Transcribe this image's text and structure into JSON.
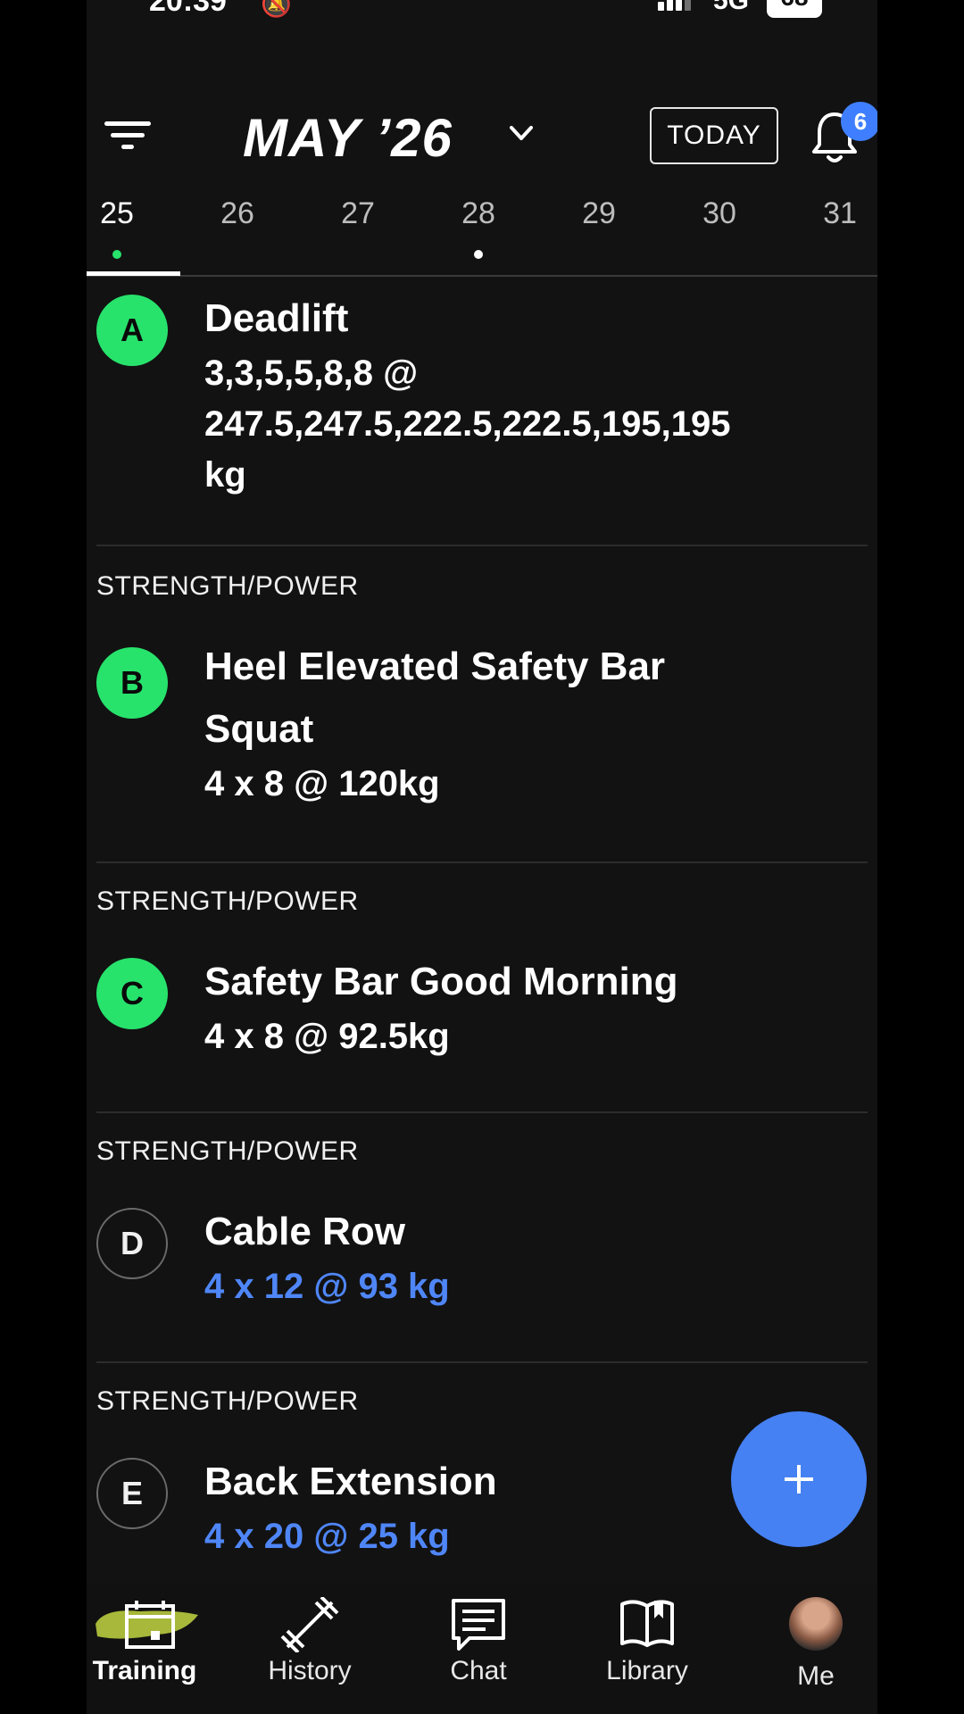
{
  "status_bar": {
    "time": "20:39",
    "network": "5G",
    "battery": "68"
  },
  "header": {
    "month": "MAY ’26",
    "today_label": "TODAY",
    "notification_count": "6"
  },
  "days": [
    {
      "label": "25",
      "active": true,
      "dot": "#27e36c"
    },
    {
      "label": "26"
    },
    {
      "label": "27"
    },
    {
      "label": "28",
      "dot": "#ffffff"
    },
    {
      "label": "29"
    },
    {
      "label": "30"
    },
    {
      "label": "31"
    }
  ],
  "exercises": [
    {
      "letter": "A",
      "category": "",
      "name_lines": [
        "Deadlift"
      ],
      "detail_lines": [
        "3,3,5,5,8,8 @",
        "247.5,247.5,222.5,222.5,195,195",
        "kg"
      ],
      "done": true
    },
    {
      "letter": "B",
      "category": "STRENGTH/POWER",
      "name_lines": [
        "Heel Elevated Safety Bar",
        "Squat"
      ],
      "detail_lines": [
        "4 x 8 @ 120kg"
      ],
      "done": true
    },
    {
      "letter": "C",
      "category": "STRENGTH/POWER",
      "name_lines": [
        "Safety Bar Good Morning"
      ],
      "detail_lines": [
        "4 x 8 @ 92.5kg"
      ],
      "done": true
    },
    {
      "letter": "D",
      "category": "STRENGTH/POWER",
      "name_lines": [
        "Cable Row"
      ],
      "detail_lines": [
        "4 x 12 @ 93 kg"
      ],
      "done": false
    },
    {
      "letter": "E",
      "category": "STRENGTH/POWER",
      "name_lines": [
        "Back Extension"
      ],
      "detail_lines": [
        "4 x 20 @ 25 kg"
      ],
      "done": false
    }
  ],
  "fab": {
    "icon": "plus-icon"
  },
  "nav": {
    "training": "Training",
    "history": "History",
    "chat": "Chat",
    "library": "Library",
    "me": "Me"
  },
  "colors": {
    "accent_green": "#27e36c",
    "accent_blue": "#4581f3",
    "pending_text_blue": "#4f86f7",
    "background": "#121212"
  }
}
